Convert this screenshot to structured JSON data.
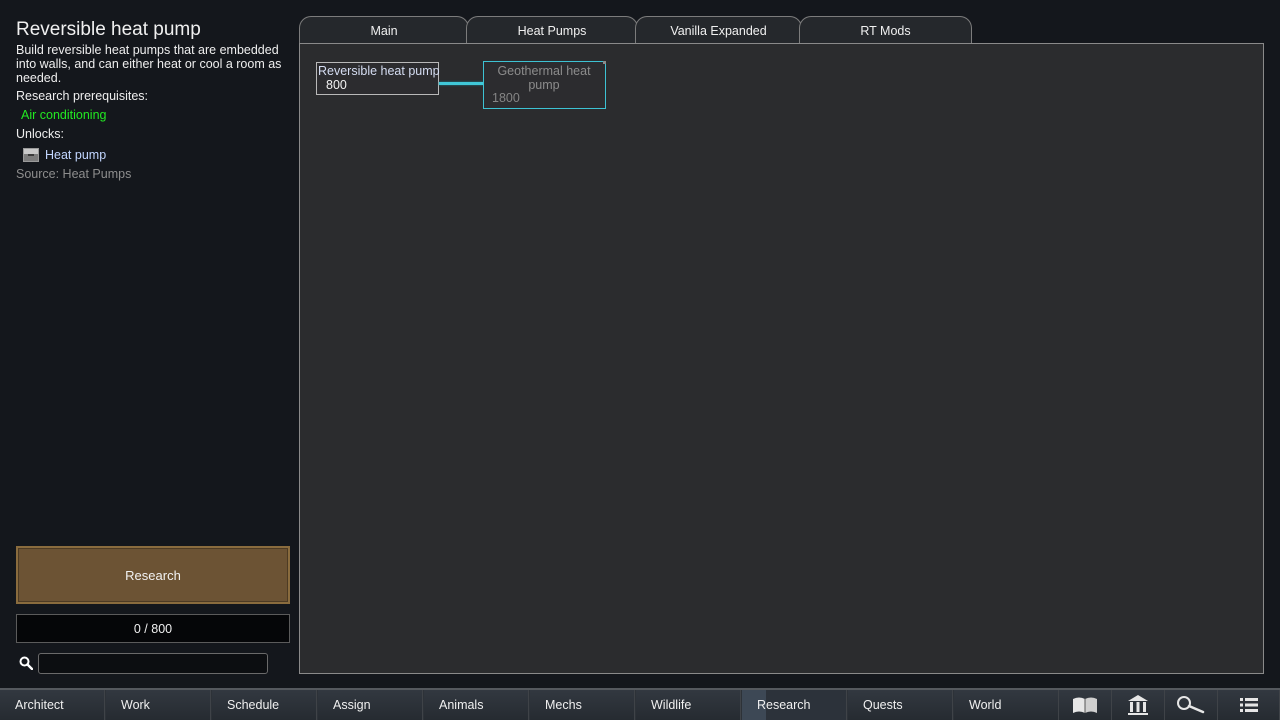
{
  "project": {
    "title": "Reversible heat pump",
    "description": "Build reversible heat pumps that are embedded into walls, and can either heat or cool a room as needed.",
    "prerequisites_label": "Research prerequisites:",
    "prerequisites": [
      "Air conditioning"
    ],
    "unlocks_label": "Unlocks:",
    "unlocks": [
      {
        "label": "Heat pump",
        "icon": "heat-pump-icon"
      }
    ],
    "source": "Source:  Heat Pumps"
  },
  "research_button": {
    "label": "Research",
    "color": "#6c5334"
  },
  "progress": {
    "text": "0 / 800",
    "current": 0,
    "total": 800
  },
  "search": {
    "value": "",
    "placeholder": ""
  },
  "tabs": [
    {
      "label": "Main"
    },
    {
      "label": "Heat Pumps"
    },
    {
      "label": "Vanilla Expanded"
    },
    {
      "label": "RT Mods"
    }
  ],
  "tree": {
    "nodes": [
      {
        "name": "Reversible heat pump",
        "cost": "800",
        "state": "selected"
      },
      {
        "name": "Geothermal heat pump",
        "cost": "1800",
        "state": "locked"
      }
    ],
    "link_color": "#40c8d8"
  },
  "bottom_bar": {
    "buttons": [
      "Architect",
      "Work",
      "Schedule",
      "Assign",
      "Animals",
      "Mechs",
      "Wildlife",
      "Research",
      "Quests",
      "World"
    ],
    "active": "Research",
    "icons": [
      "book-icon",
      "factions-icon",
      "history-icon",
      "menu-icon"
    ]
  }
}
